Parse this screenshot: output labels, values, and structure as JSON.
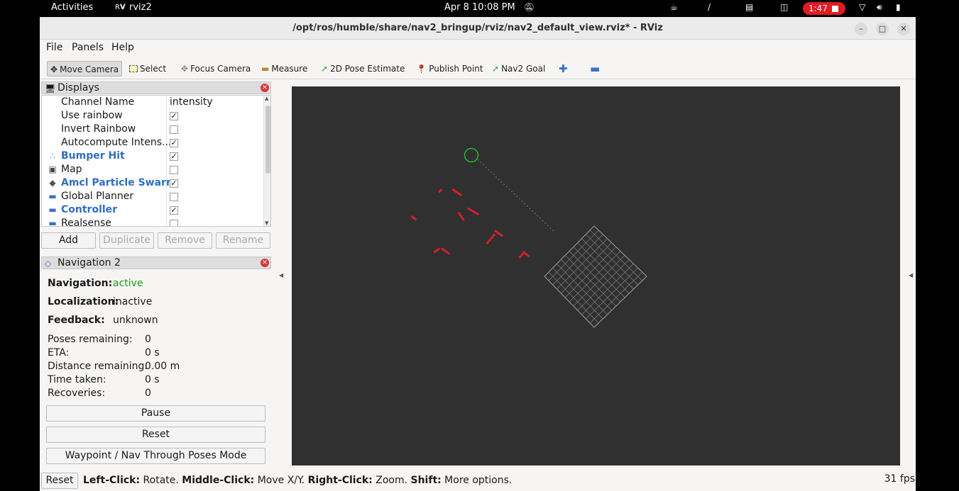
{
  "topbar": {
    "activities": "Activities",
    "app_name": "rviz2",
    "datetime": "Apr 8  10:08 PM",
    "recording_time": "1:47"
  },
  "window": {
    "title": "/opt/ros/humble/share/nav2_bringup/rviz/nav2_default_view.rviz* - RViz"
  },
  "menu": {
    "file": "File",
    "panels": "Panels",
    "help": "Help"
  },
  "toolbar": {
    "move_camera": "Move Camera",
    "select": "Select",
    "focus_camera": "Focus Camera",
    "measure": "Measure",
    "pose_estimate": "2D Pose Estimate",
    "publish_point": "Publish Point",
    "nav2_goal": "Nav2 Goal"
  },
  "displays": {
    "title": "Displays",
    "rows": [
      {
        "name": "Channel Name",
        "value": "intensity"
      },
      {
        "name": "Use rainbow",
        "checked": "✓"
      },
      {
        "name": "Invert Rainbow",
        "checked": ""
      },
      {
        "name": "Autocompute Intens...",
        "checked": "✓"
      },
      {
        "name": "Bumper Hit",
        "checked": "✓"
      },
      {
        "name": "Map",
        "checked": ""
      },
      {
        "name": "Amcl Particle Swarm",
        "checked": "✓"
      },
      {
        "name": "Global Planner",
        "checked": ""
      },
      {
        "name": "Controller",
        "checked": "✓"
      },
      {
        "name": "Realsense",
        "checked": ""
      }
    ],
    "buttons": {
      "add": "Add",
      "duplicate": "Duplicate",
      "remove": "Remove",
      "rename": "Rename"
    }
  },
  "navigation": {
    "title": "Navigation 2",
    "navigation_label": "Navigation:",
    "navigation_value": "active",
    "localization_label": "Localization:",
    "localization_value": "inactive",
    "feedback_label": "Feedback:",
    "feedback_value": "unknown",
    "stats": [
      {
        "label": "Poses remaining:",
        "value": "0"
      },
      {
        "label": "ETA:",
        "value": "0 s"
      },
      {
        "label": "Distance remaining:",
        "value": "0.00 m"
      },
      {
        "label": "Time taken:",
        "value": "0 s"
      },
      {
        "label": "Recoveries:",
        "value": "0"
      }
    ],
    "pause": "Pause",
    "reset": "Reset",
    "waypoint_mode": "Waypoint / Nav Through Poses Mode"
  },
  "statusbar": {
    "reset": "Reset",
    "left_click": "Left-Click:",
    "left_click_action": " Rotate. ",
    "middle_click": "Middle-Click:",
    "middle_click_action": " Move X/Y. ",
    "right_click": "Right-Click:",
    "right_click_action": " Zoom. ",
    "shift": "Shift:",
    "shift_action": " More options.",
    "fps": "31 fps"
  },
  "colors": {
    "viewport_bg": "#303030",
    "laser_points": "#d0202a",
    "goal_marker": "#1fcf2f",
    "grid": "#a0a0a0",
    "nav_active": "#1e9a1e",
    "display_highlight": "#2f6ec4"
  }
}
